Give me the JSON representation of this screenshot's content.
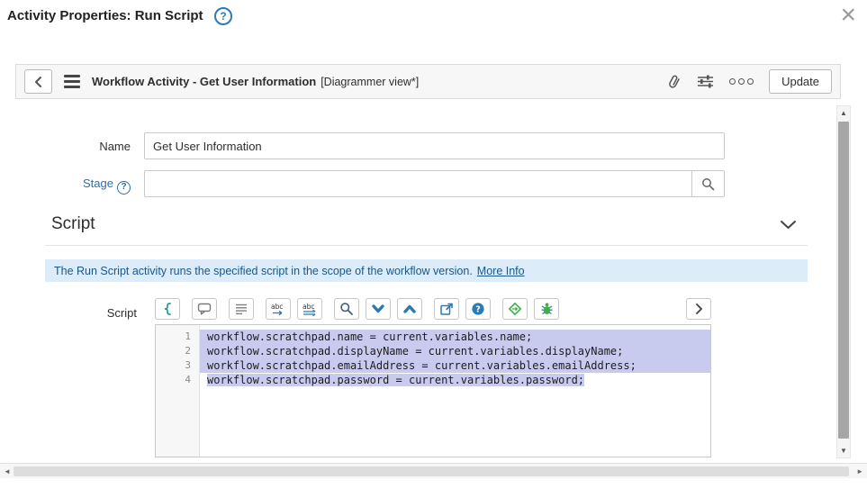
{
  "dialog": {
    "title": "Activity Properties: Run Script"
  },
  "icons": {
    "close": "×",
    "help": "?",
    "abc": "abc",
    "up_arrow": "▲",
    "down_arrow": "▼",
    "left_arrow": "◄",
    "right_arrow": "►"
  },
  "toolbar": {
    "title": "Workflow Activity - Get User Information",
    "view": "[Diagrammer view*]",
    "update": "Update"
  },
  "form": {
    "name_label": "Name",
    "name_value": "Get User Information",
    "stage_label": "Stage",
    "stage_value": ""
  },
  "section": {
    "title": "Script"
  },
  "banner": {
    "text": "The Run Script activity runs the specified script in the scope of the workflow version.",
    "link": "More Info"
  },
  "editor": {
    "label": "Script",
    "lines": [
      {
        "num": "1",
        "code": "workflow.scratchpad.name = current.variables.name;"
      },
      {
        "num": "2",
        "code": "workflow.scratchpad.displayName = current.variables.displayName;"
      },
      {
        "num": "3",
        "code": "workflow.scratchpad.emailAddress = current.variables.emailAddress;"
      },
      {
        "num": "4",
        "code": "workflow.scratchpad.password = current.variables.password;"
      }
    ]
  },
  "colors": {
    "accent_blue": "#2a7ab5",
    "banner_bg": "#dcecf8",
    "banner_text": "#19578c",
    "selection": "#c8cbee",
    "icon_green": "#3fae49",
    "icon_teal": "#1a9e8f"
  }
}
